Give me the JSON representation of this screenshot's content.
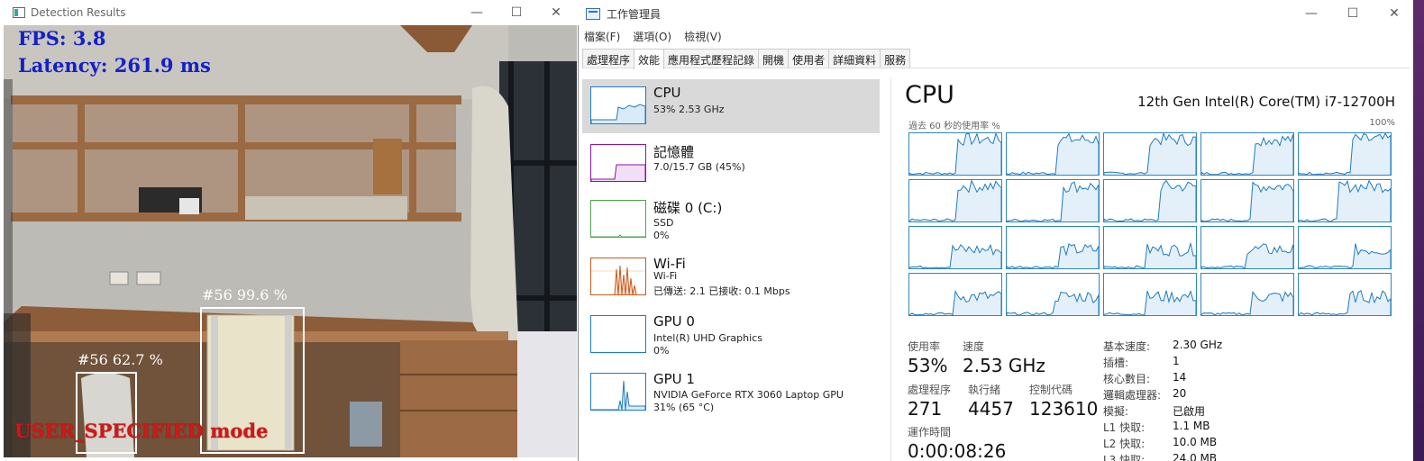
{
  "detection_window": {
    "title": "Detection Results",
    "fps_text": "FPS: 3.8",
    "latency_text": "Latency: 261.9 ms",
    "mode_text": "USER_SPECIFIED mode",
    "detections": [
      {
        "label": "#56  99.6 %"
      },
      {
        "label": "#56  62.7 %"
      }
    ],
    "controls": {
      "minimize": "—",
      "maximize": "☐",
      "close": "✕"
    }
  },
  "task_manager": {
    "title": "工作管理員",
    "menu": [
      "檔案(F)",
      "選項(O)",
      "檢視(V)"
    ],
    "tabs": [
      "處理程序",
      "效能",
      "應用程式歷程記錄",
      "開機",
      "使用者",
      "詳細資料",
      "服務"
    ],
    "active_tab": "效能",
    "sidebar": [
      {
        "name": "CPU",
        "line1": "53%  2.53 GHz",
        "line2": "",
        "color": "#1e7bc4"
      },
      {
        "name": "記憶體",
        "line1": "7.0/15.7 GB (45%)",
        "line2": "",
        "color": "#8b12ae"
      },
      {
        "name": "磁碟 0 (C:)",
        "line1": "SSD",
        "line2": "0%",
        "color": "#4ca64c"
      },
      {
        "name": "Wi-Fi",
        "line1": "Wi-Fi",
        "line2": "已傳送: 2.1  已接收: 0.1 Mbps",
        "color": "#c85a19"
      },
      {
        "name": "GPU 0",
        "line1": "Intel(R) UHD Graphics",
        "line2": "0%",
        "color": "#1e7bc4"
      },
      {
        "name": "GPU 1",
        "line1": "NVIDIA GeForce RTX 3060 Laptop GPU",
        "line2": "31% (65 °C)",
        "color": "#1e7bc4"
      }
    ],
    "cpu": {
      "title": "CPU",
      "model": "12th Gen Intel(R) Core(TM) i7-12700H",
      "util_label": "過去 60 秒的使用率 %",
      "util_max": "100%",
      "utilization_label": "使用率",
      "utilization": "53%",
      "speed_label": "速度",
      "speed": "2.53 GHz",
      "processes_label": "處理程序",
      "processes": "271",
      "threads_label": "執行緒",
      "threads": "4457",
      "handles_label": "控制代碼",
      "handles": "123610",
      "uptime_label": "運作時間",
      "uptime": "0:00:08:26",
      "specs": [
        {
          "k": "基本速度:",
          "v": "2.30 GHz"
        },
        {
          "k": "插槽:",
          "v": "1"
        },
        {
          "k": "核心數目:",
          "v": "14"
        },
        {
          "k": "邏輯處理器:",
          "v": "20"
        },
        {
          "k": "模擬:",
          "v": "已啟用"
        },
        {
          "k": "L1 快取:",
          "v": "1.1 MB"
        },
        {
          "k": "L2 快取:",
          "v": "10.0 MB"
        },
        {
          "k": "L3 快取:",
          "v": "24.0 MB"
        }
      ]
    }
  }
}
